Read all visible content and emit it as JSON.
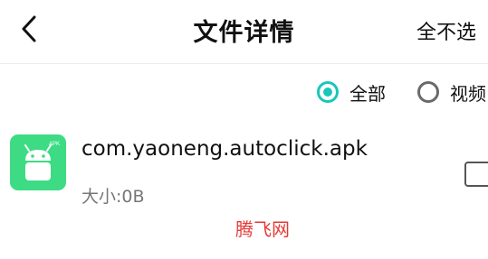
{
  "header": {
    "title": "文件详情",
    "deselect_all_label": "全不选"
  },
  "filters": [
    {
      "label": "全部",
      "selected": true
    },
    {
      "label": "视频",
      "selected": false
    }
  ],
  "files": [
    {
      "icon": "android-apk-icon",
      "icon_badge": "APK",
      "name": "com.yaoneng.autoclick.apk",
      "size": "大小:0B",
      "checked": false
    }
  ],
  "watermark": "腾飞网",
  "colors": {
    "accent": "#19c7b9",
    "apk_icon": "#3ddc84",
    "watermark": "#e53935"
  }
}
